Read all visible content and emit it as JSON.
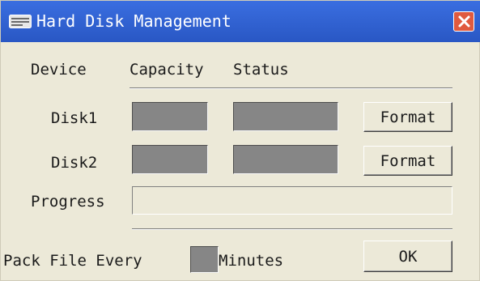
{
  "window": {
    "title": "Hard Disk Management",
    "title_icon": "hard-disk-icon",
    "close_icon": "close-icon"
  },
  "columns": {
    "device": "Device",
    "capacity": "Capacity",
    "status": "Status"
  },
  "disks": [
    {
      "label": "Disk1",
      "capacity": "",
      "status": "",
      "button": "Format"
    },
    {
      "label": "Disk2",
      "capacity": "",
      "status": "",
      "button": "Format"
    }
  ],
  "progress": {
    "label": "Progress",
    "value": 0
  },
  "pack": {
    "prefix": "Pack File Every",
    "value": "",
    "suffix": "Minutes"
  },
  "ok_label": "OK",
  "colors": {
    "titlebar": "#2f5fc7",
    "close_button": "#e05a3f",
    "window_bg": "#ece9d8",
    "field_fill": "#868686"
  }
}
